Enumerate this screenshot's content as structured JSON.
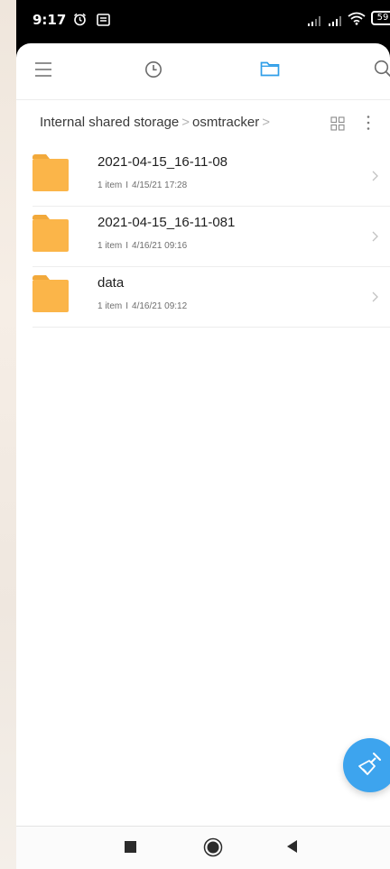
{
  "status_bar": {
    "time": "9:17",
    "battery": "59",
    "icons": [
      "alarm-icon",
      "message-icon",
      "signal-icon",
      "signal-icon",
      "wifi-icon",
      "battery-icon"
    ]
  },
  "toolbar": {
    "icons": [
      "menu-icon",
      "history-icon",
      "folder-icon",
      "search-icon"
    ],
    "active_color": "#2f9ee8"
  },
  "breadcrumb": {
    "items": [
      "Internal shared storage",
      "osmtracker"
    ],
    "separator": ">"
  },
  "files": [
    {
      "name": "2021-04-15_16-11-08",
      "count": "1 item",
      "separator": "I",
      "date": "4/15/21 17:28"
    },
    {
      "name": "2021-04-15_16-11-081",
      "count": "1 item",
      "separator": "I",
      "date": "4/16/21 09:16"
    },
    {
      "name": "data",
      "count": "1 item",
      "separator": "I",
      "date": "4/16/21 09:12"
    }
  ],
  "colors": {
    "folder": "#fbb549",
    "folder_tab": "#f2a93b",
    "fab": "#3da4ee",
    "accent": "#2f9ee8"
  },
  "fab_icon": "clean-brush-icon",
  "nav_icons": [
    "recent-apps-icon",
    "home-icon",
    "back-icon"
  ]
}
